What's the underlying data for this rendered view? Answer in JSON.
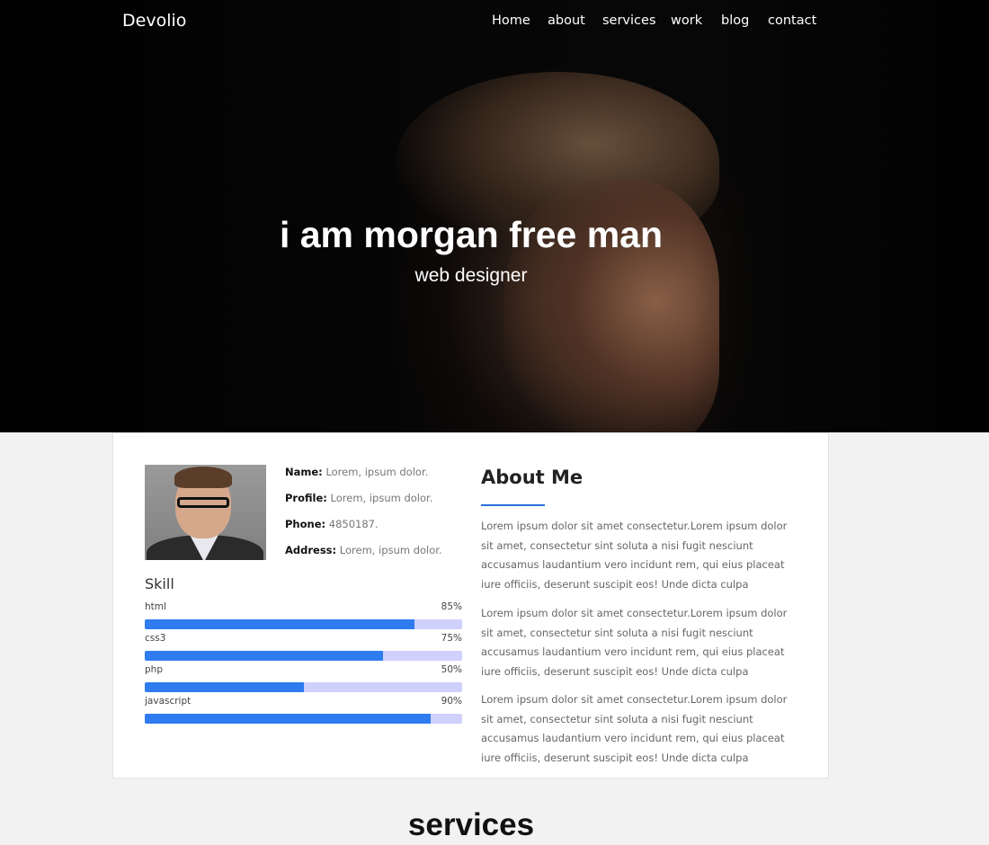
{
  "brand": "Devolio",
  "nav": [
    {
      "label": "Home"
    },
    {
      "label": "about"
    },
    {
      "label": "services"
    },
    {
      "label": "work"
    },
    {
      "label": "blog"
    },
    {
      "label": "contact"
    }
  ],
  "hero": {
    "title": "i am morgan free man",
    "subtitle": "web designer"
  },
  "profile": {
    "fields": [
      {
        "label": "Name:",
        "value": "Lorem, ipsum dolor."
      },
      {
        "label": "Profile:",
        "value": "Lorem, ipsum dolor."
      },
      {
        "label": "Phone:",
        "value": "4850187."
      },
      {
        "label": "Address:",
        "value": "Lorem, ipsum dolor."
      }
    ]
  },
  "skills": {
    "title": "Skill",
    "items": [
      {
        "name": "html",
        "percent_label": "85%",
        "level": 0.85
      },
      {
        "name": "css3",
        "percent_label": "75%",
        "level": 0.75
      },
      {
        "name": "php",
        "percent_label": "50%",
        "level": 0.5
      },
      {
        "name": "javascript",
        "percent_label": "90%",
        "level": 0.9
      }
    ]
  },
  "about": {
    "title": "About Me",
    "paragraphs": [
      "Lorem ipsum dolor sit amet consectetur.Lorem ipsum dolor sit amet, consectetur sint soluta a nisi fugit nesciunt accusamus laudantium vero incidunt rem, qui eius placeat iure officiis, deserunt suscipit eos! Unde dicta culpa",
      "Lorem ipsum dolor sit amet consectetur.Lorem ipsum dolor sit amet, consectetur sint soluta a nisi fugit nesciunt accusamus laudantium vero incidunt rem, qui eius placeat iure officiis, deserunt suscipit eos! Unde dicta culpa",
      "Lorem ipsum dolor sit amet consectetur.Lorem ipsum dolor sit amet, consectetur sint soluta a nisi fugit nesciunt accusamus laudantium vero incidunt rem, qui eius placeat iure officiis, deserunt suscipit eos! Unde dicta culpa"
    ]
  },
  "services": {
    "title": "services"
  },
  "colors": {
    "accent": "#2f7bf0",
    "skill_track": "#cfd0fb",
    "about_rule": "#2b6fd8"
  }
}
